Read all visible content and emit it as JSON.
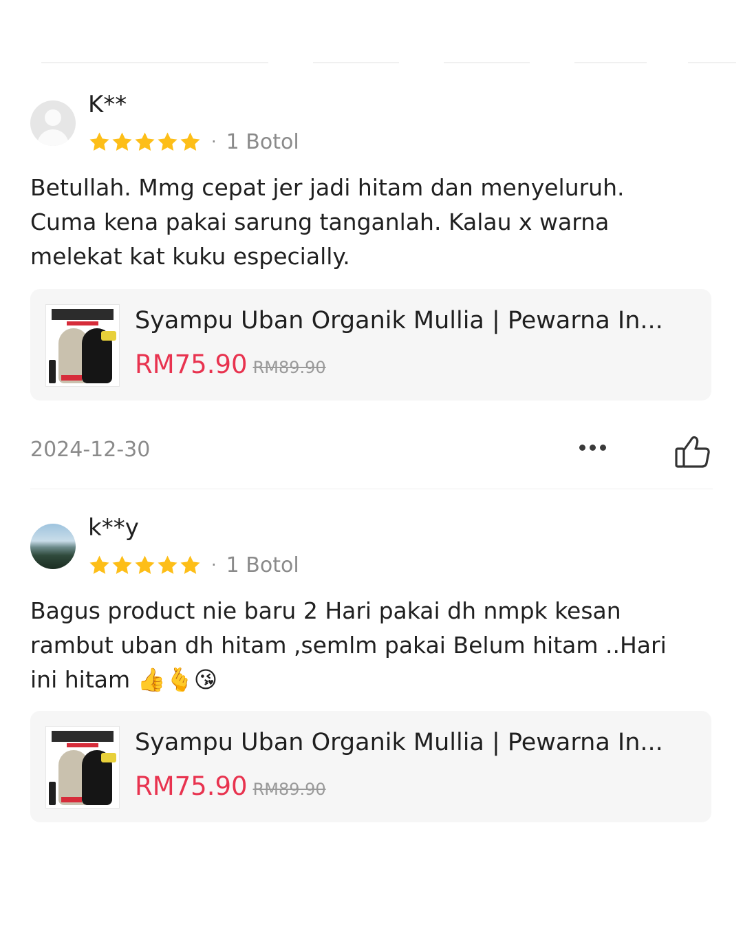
{
  "reviews": [
    {
      "username": "K**",
      "avatar": "default-user-icon",
      "stars": 5,
      "separator": "·",
      "variant": "1 Botol",
      "text": "Betullah. Mmg cepat jer jadi hitam dan menyeluruh.\nCuma kena pakai sarung tanganlah. Kalau x warna\nmelekat kat kuku especially.",
      "product": {
        "title": "Syampu Uban Organik Mullia | Pewarna In...",
        "price": "RM75.90",
        "old_price": "RM89.90",
        "thumb_text": "RAMBUT BEBAS UBAN"
      },
      "date": "2024-12-30"
    },
    {
      "username": "k**y",
      "avatar": "landscape-photo",
      "stars": 5,
      "separator": "·",
      "variant": "1 Botol",
      "text": "Bagus product nie baru 2 Hari pakai dh nmpk kesan\nrambut uban dh hitam ,semlm pakai Belum hitam ..Hari\nini hitam 👍🫰😘",
      "product": {
        "title": "Syampu Uban Organik Mullia | Pewarna In...",
        "price": "RM75.90",
        "old_price": "RM89.90",
        "thumb_text": "RAMBUT BEBAS UBAN"
      }
    }
  ],
  "colors": {
    "star": "#FDBE18",
    "price": "#E8334F",
    "muted": "#8a8a8a"
  }
}
